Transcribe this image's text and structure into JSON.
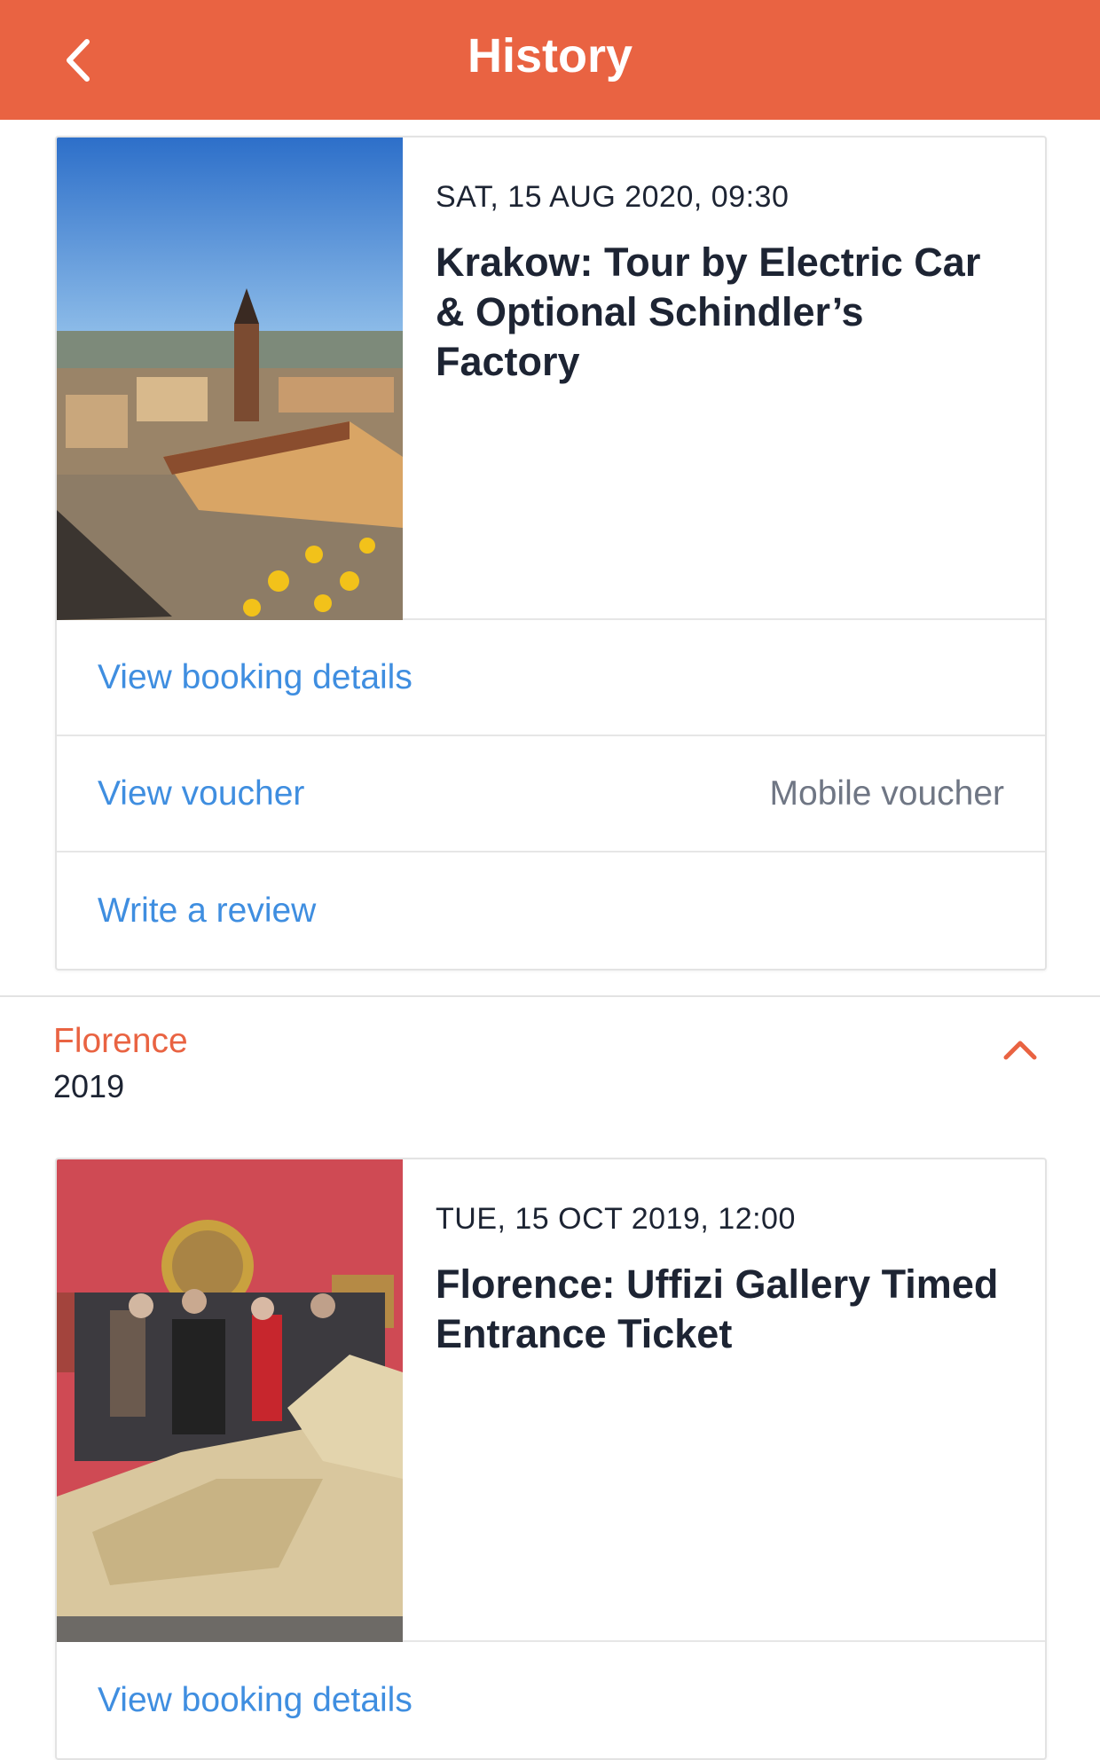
{
  "header": {
    "title": "History",
    "back_icon": "chevron-left-icon",
    "background_color": "#e96342"
  },
  "bookings": [
    {
      "date": "SAT, 15 AUG 2020, 09:30",
      "title": "Krakow: Tour by Electric Car & Optional Schindler’s Factory",
      "image": "krakow-market-square-photo",
      "actions": {
        "details": "View booking details",
        "voucher": "View voucher",
        "voucher_type": "Mobile voucher",
        "review": "Write a review"
      }
    },
    {
      "date": "TUE, 15 OCT 2019, 12:00",
      "title": "Florence: Uffizi Gallery Timed Entrance Ticket",
      "image": "uffizi-gallery-sculpture-photo",
      "actions": {
        "details": "View booking details"
      }
    }
  ],
  "sections": [
    {
      "city": "Florence",
      "year": "2019",
      "toggle_icon": "chevron-up-icon"
    }
  ],
  "colors": {
    "accent": "#e96342",
    "link": "#3f8ee0",
    "text": "#1d2433",
    "muted": "#6f7684"
  }
}
